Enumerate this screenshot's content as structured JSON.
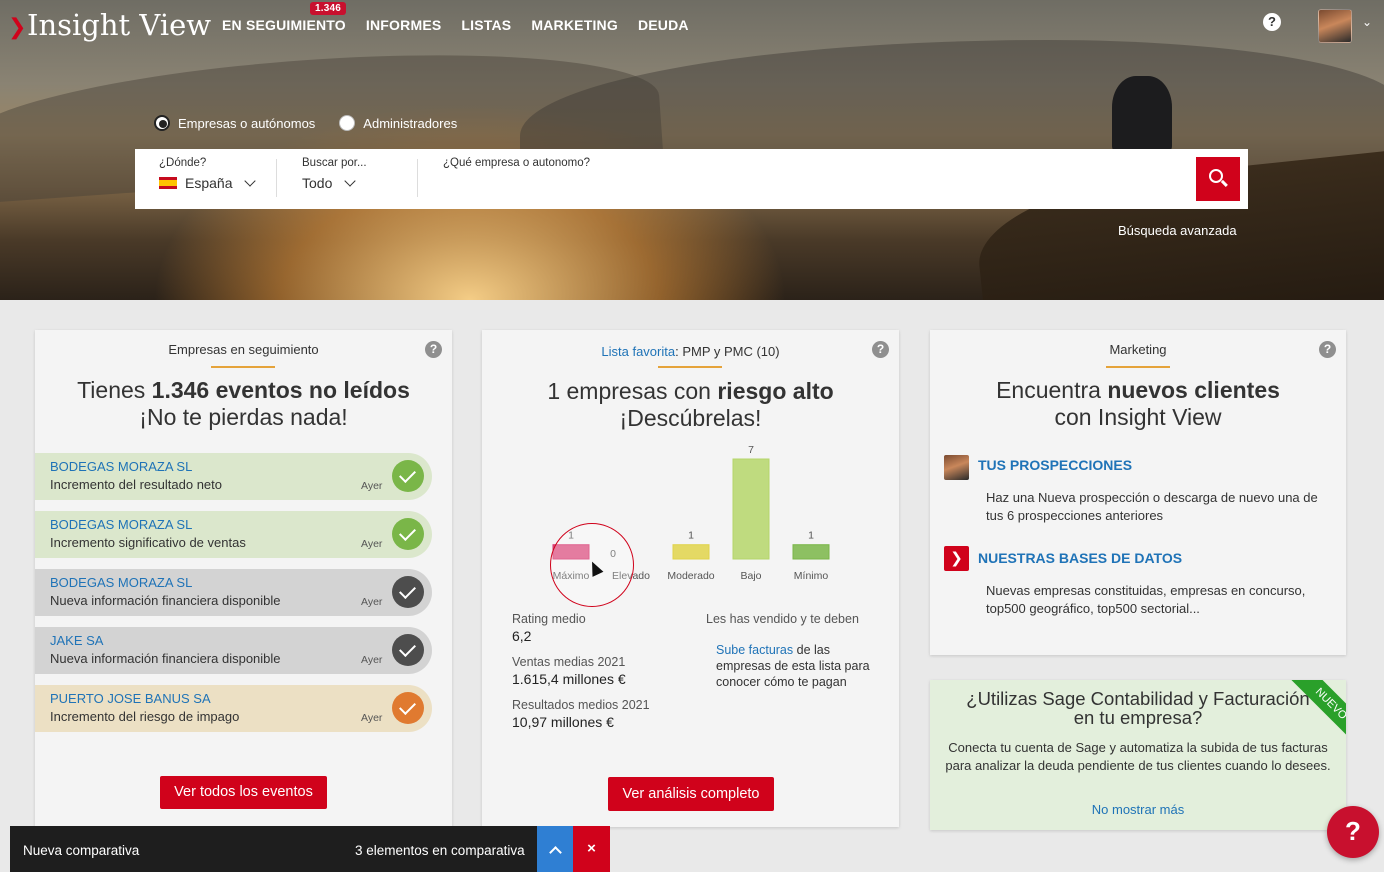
{
  "app": {
    "title": "Insight View"
  },
  "nav": {
    "items": [
      "EN SEGUIMIENTO",
      "INFORMES",
      "LISTAS",
      "MARKETING",
      "DEUDA"
    ],
    "badge": "1.346"
  },
  "icons": {
    "help": "help-circle-icon",
    "avatar": "user-avatar",
    "search": "search-icon"
  },
  "search": {
    "type_options": [
      "Empresas o autónomos",
      "Administradores"
    ],
    "selected_type": "Empresas o autónomos",
    "where_label": "¿Dónde?",
    "where_value": "España",
    "by_label": "Buscar por...",
    "by_value": "Todo",
    "query_label": "¿Qué empresa o autonomo?",
    "query_value": "",
    "advanced": "Búsqueda avanzada"
  },
  "tracking_card": {
    "title": "Empresas en seguimiento",
    "headline_pre": "Tienes ",
    "headline_bold": "1.346 eventos no leídos",
    "headline_line2": "¡No te pierdas nada!",
    "events": [
      {
        "company": "BODEGAS MORAZA SL",
        "description": "Incremento del resultado neto",
        "when": "Ayer",
        "status": "positive"
      },
      {
        "company": "BODEGAS MORAZA SL",
        "description": "Incremento significativo de ventas",
        "when": "Ayer",
        "status": "positive"
      },
      {
        "company": "BODEGAS MORAZA SL",
        "description": "Nueva información financiera disponible",
        "when": "Ayer",
        "status": "neutral"
      },
      {
        "company": "JAKE SA",
        "description": "Nueva información financiera disponible",
        "when": "Ayer",
        "status": "neutral"
      },
      {
        "company": "PUERTO JOSE BANUS SA",
        "description": "Incremento del riesgo de impago",
        "when": "Ayer",
        "status": "warning"
      }
    ],
    "button": "Ver todos los eventos"
  },
  "risk_card": {
    "fav_link": "Lista favorita",
    "fav_rest": ": PMP y PMC  (10)",
    "headline_pre": "1 empresas con ",
    "headline_bold": "riesgo alto",
    "headline_line2": "¡Descúbrelas!",
    "stats": [
      {
        "label": "Rating medio",
        "value": "6,2"
      },
      {
        "label": "Ventas medias 2021",
        "value": "1.615,4 millones €"
      },
      {
        "label": "Resultados medios 2021",
        "value": "10,97 millones €"
      }
    ],
    "sold_title": "Les has vendido y te deben",
    "sold_link": "Sube facturas",
    "sold_rest_1": " de las",
    "sold_line2": "empresas de esta lista para",
    "sold_line3": "conocer cómo te pagan",
    "button": "Ver análisis completo"
  },
  "chart_data": {
    "type": "bar",
    "categories": [
      "Máximo",
      "Elevado",
      "Moderado",
      "Bajo",
      "Mínimo"
    ],
    "values": [
      1,
      0,
      1,
      7,
      1
    ],
    "colors": [
      "#d6336c",
      "#cccccc",
      "#e0d34a",
      "#b5d66a",
      "#7ab648"
    ]
  },
  "marketing_card": {
    "title": "Marketing",
    "headline_pre": "Encuentra ",
    "headline_bold": "nuevos clientes",
    "headline_line2": "con Insight View",
    "sections": [
      {
        "heading": "TUS PROSPECCIONES",
        "text": "Haz una Nueva prospección o descarga de nuevo una de tus 6 prospecciones anteriores"
      },
      {
        "heading": "NUESTRAS BASES DE DATOS",
        "text": "Nuevas empresas constituidas, empresas en concurso, top500 geográfico, top500 sectorial..."
      }
    ]
  },
  "sage_card": {
    "title_line1": "¿Utilizas Sage Contabilidad y Facturación",
    "title_line2": "en tu empresa?",
    "text": "Conecta tu cuenta de Sage y automatiza la subida de tus facturas para analizar la deuda pendiente de tus clientes cuando lo desees.",
    "link": "No mostrar más",
    "ribbon": "NUEVO"
  },
  "compare_bar": {
    "title": "Nueva comparativa",
    "count_text": "3 elementos en comparativa",
    "close_symbol": "×"
  },
  "fab": {
    "label": "?"
  },
  "colors": {
    "brand_red": "#d0021b",
    "link_blue": "#1f73b7",
    "accent": "#e5a33a"
  }
}
